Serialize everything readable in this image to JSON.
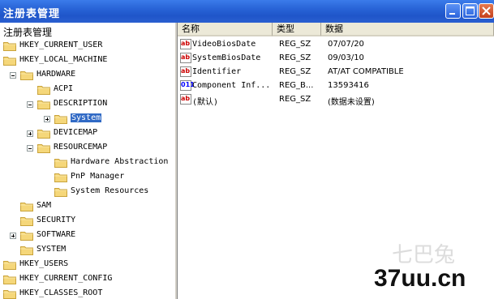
{
  "window": {
    "title": "注册表管理"
  },
  "tree": {
    "header": "注册表管理",
    "nodes": [
      {
        "label": "HKEY_CURRENT_USER",
        "level": 0,
        "toggle": ""
      },
      {
        "label": "HKEY_LOCAL_MACHINE",
        "level": 0,
        "toggle": ""
      },
      {
        "label": "HARDWARE",
        "level": 1,
        "toggle": "-"
      },
      {
        "label": "ACPI",
        "level": 2,
        "toggle": ""
      },
      {
        "label": "DESCRIPTION",
        "level": 2,
        "toggle": "-"
      },
      {
        "label": "System",
        "level": 3,
        "toggle": "+",
        "selected": true
      },
      {
        "label": "DEVICEMAP",
        "level": 2,
        "toggle": "+"
      },
      {
        "label": "RESOURCEMAP",
        "level": 2,
        "toggle": "-"
      },
      {
        "label": "Hardware Abstraction",
        "level": 3,
        "toggle": ""
      },
      {
        "label": "PnP Manager",
        "level": 3,
        "toggle": ""
      },
      {
        "label": "System Resources",
        "level": 3,
        "toggle": ""
      },
      {
        "label": "SAM",
        "level": 1,
        "toggle": ""
      },
      {
        "label": "SECURITY",
        "level": 1,
        "toggle": ""
      },
      {
        "label": "SOFTWARE",
        "level": 1,
        "toggle": "+"
      },
      {
        "label": "SYSTEM",
        "level": 1,
        "toggle": ""
      },
      {
        "label": "HKEY_USERS",
        "level": 0,
        "toggle": ""
      },
      {
        "label": "HKEY_CURRENT_CONFIG",
        "level": 0,
        "toggle": ""
      },
      {
        "label": "HKEY_CLASSES_ROOT",
        "level": 0,
        "toggle": ""
      }
    ]
  },
  "list": {
    "columns": [
      "名称",
      "类型",
      "数据"
    ],
    "rows": [
      {
        "name": "VideoBiosDate",
        "type": "REG_SZ",
        "data": "07/07/20",
        "icon": "string-value-icon"
      },
      {
        "name": "SystemBiosDate",
        "type": "REG_SZ",
        "data": "09/03/10",
        "icon": "string-value-icon"
      },
      {
        "name": "Identifier",
        "type": "REG_SZ",
        "data": "AT/AT COMPATIBLE",
        "icon": "string-value-icon"
      },
      {
        "name": "Component Inf...",
        "type": "REG_B...",
        "data": "13593416",
        "icon": "binary-value-icon"
      },
      {
        "name": "(默认)",
        "type": "REG_SZ",
        "data": "(数据未设置)",
        "icon": "string-value-icon"
      }
    ]
  },
  "icon_labels": {
    "string": "ab",
    "binary": "011"
  },
  "watermark": {
    "text": "37uu.cn",
    "faint": "七巴兔"
  }
}
